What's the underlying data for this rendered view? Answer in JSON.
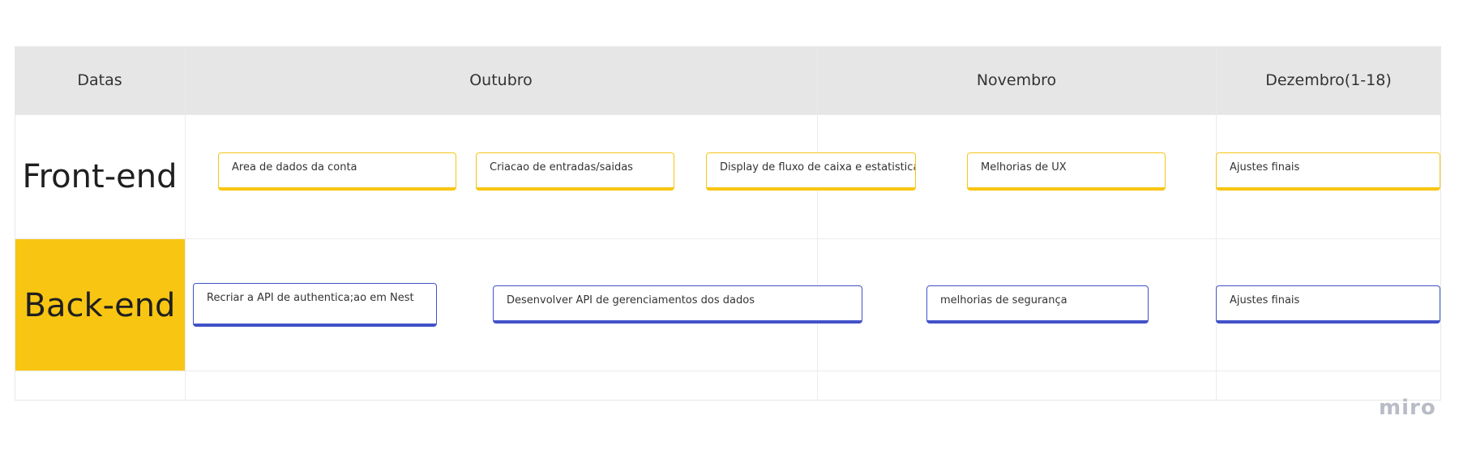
{
  "header": {
    "dates_label": "Datas",
    "months": [
      "Outubro",
      "Novembro",
      "Dezembro(1-18)"
    ]
  },
  "rows": {
    "frontend_label": "Front-end",
    "backend_label": "Back-end"
  },
  "frontend_tasks": [
    "Area de dados da conta",
    "Criacao de entradas/saidas",
    "Display de fluxo de caixa e estatisticas",
    "Melhorias de UX",
    "Ajustes finais"
  ],
  "backend_tasks": [
    "Recriar a API de authentica;ao em Nest",
    "Desenvolver API de gerenciamentos dos dados",
    "melhorias de segurança",
    "Ajustes finais"
  ],
  "brand": "miro",
  "colors": {
    "header_bg": "#e6e6e6",
    "backend_label_bg": "#f8c513",
    "frontend_card_accent": "#f8c513",
    "backend_card_accent": "#4152c8"
  }
}
